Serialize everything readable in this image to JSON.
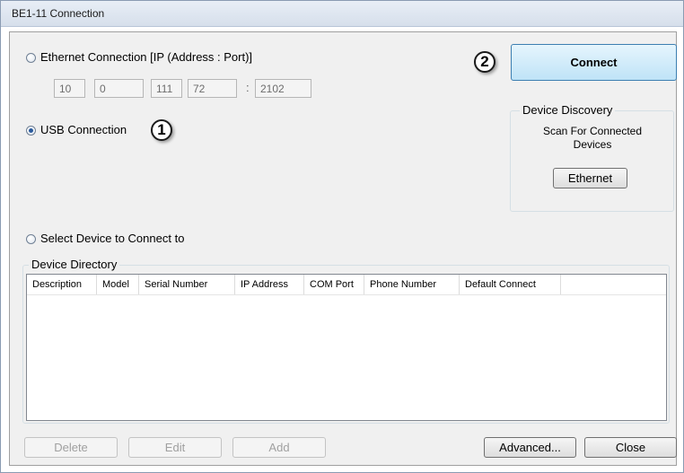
{
  "window": {
    "title": "BE1-11 Connection"
  },
  "ethernet": {
    "label": "Ethernet Connection [IP (Address : Port)]",
    "ip": [
      "10",
      "0",
      "111",
      "72"
    ],
    "port_separator": ":",
    "port": "2102"
  },
  "usb": {
    "label": "USB Connection"
  },
  "select_device": {
    "label": "Select Device to Connect to"
  },
  "markers": {
    "one": "1",
    "two": "2"
  },
  "connect_label": "Connect",
  "discovery": {
    "title": "Device Discovery",
    "text": "Scan For Connected Devices",
    "ethernet_button": "Ethernet"
  },
  "directory": {
    "title": "Device Directory",
    "columns": [
      "Description",
      "Model",
      "Serial Number",
      "IP Address",
      "COM Port",
      "Phone Number",
      "Default Connect"
    ]
  },
  "buttons": {
    "delete": "Delete",
    "edit": "Edit",
    "add": "Add",
    "advanced": "Advanced...",
    "close": "Close"
  },
  "colors": {
    "connect_accent": "#bfe3f7",
    "radio_selected": "#2a5a9c"
  }
}
